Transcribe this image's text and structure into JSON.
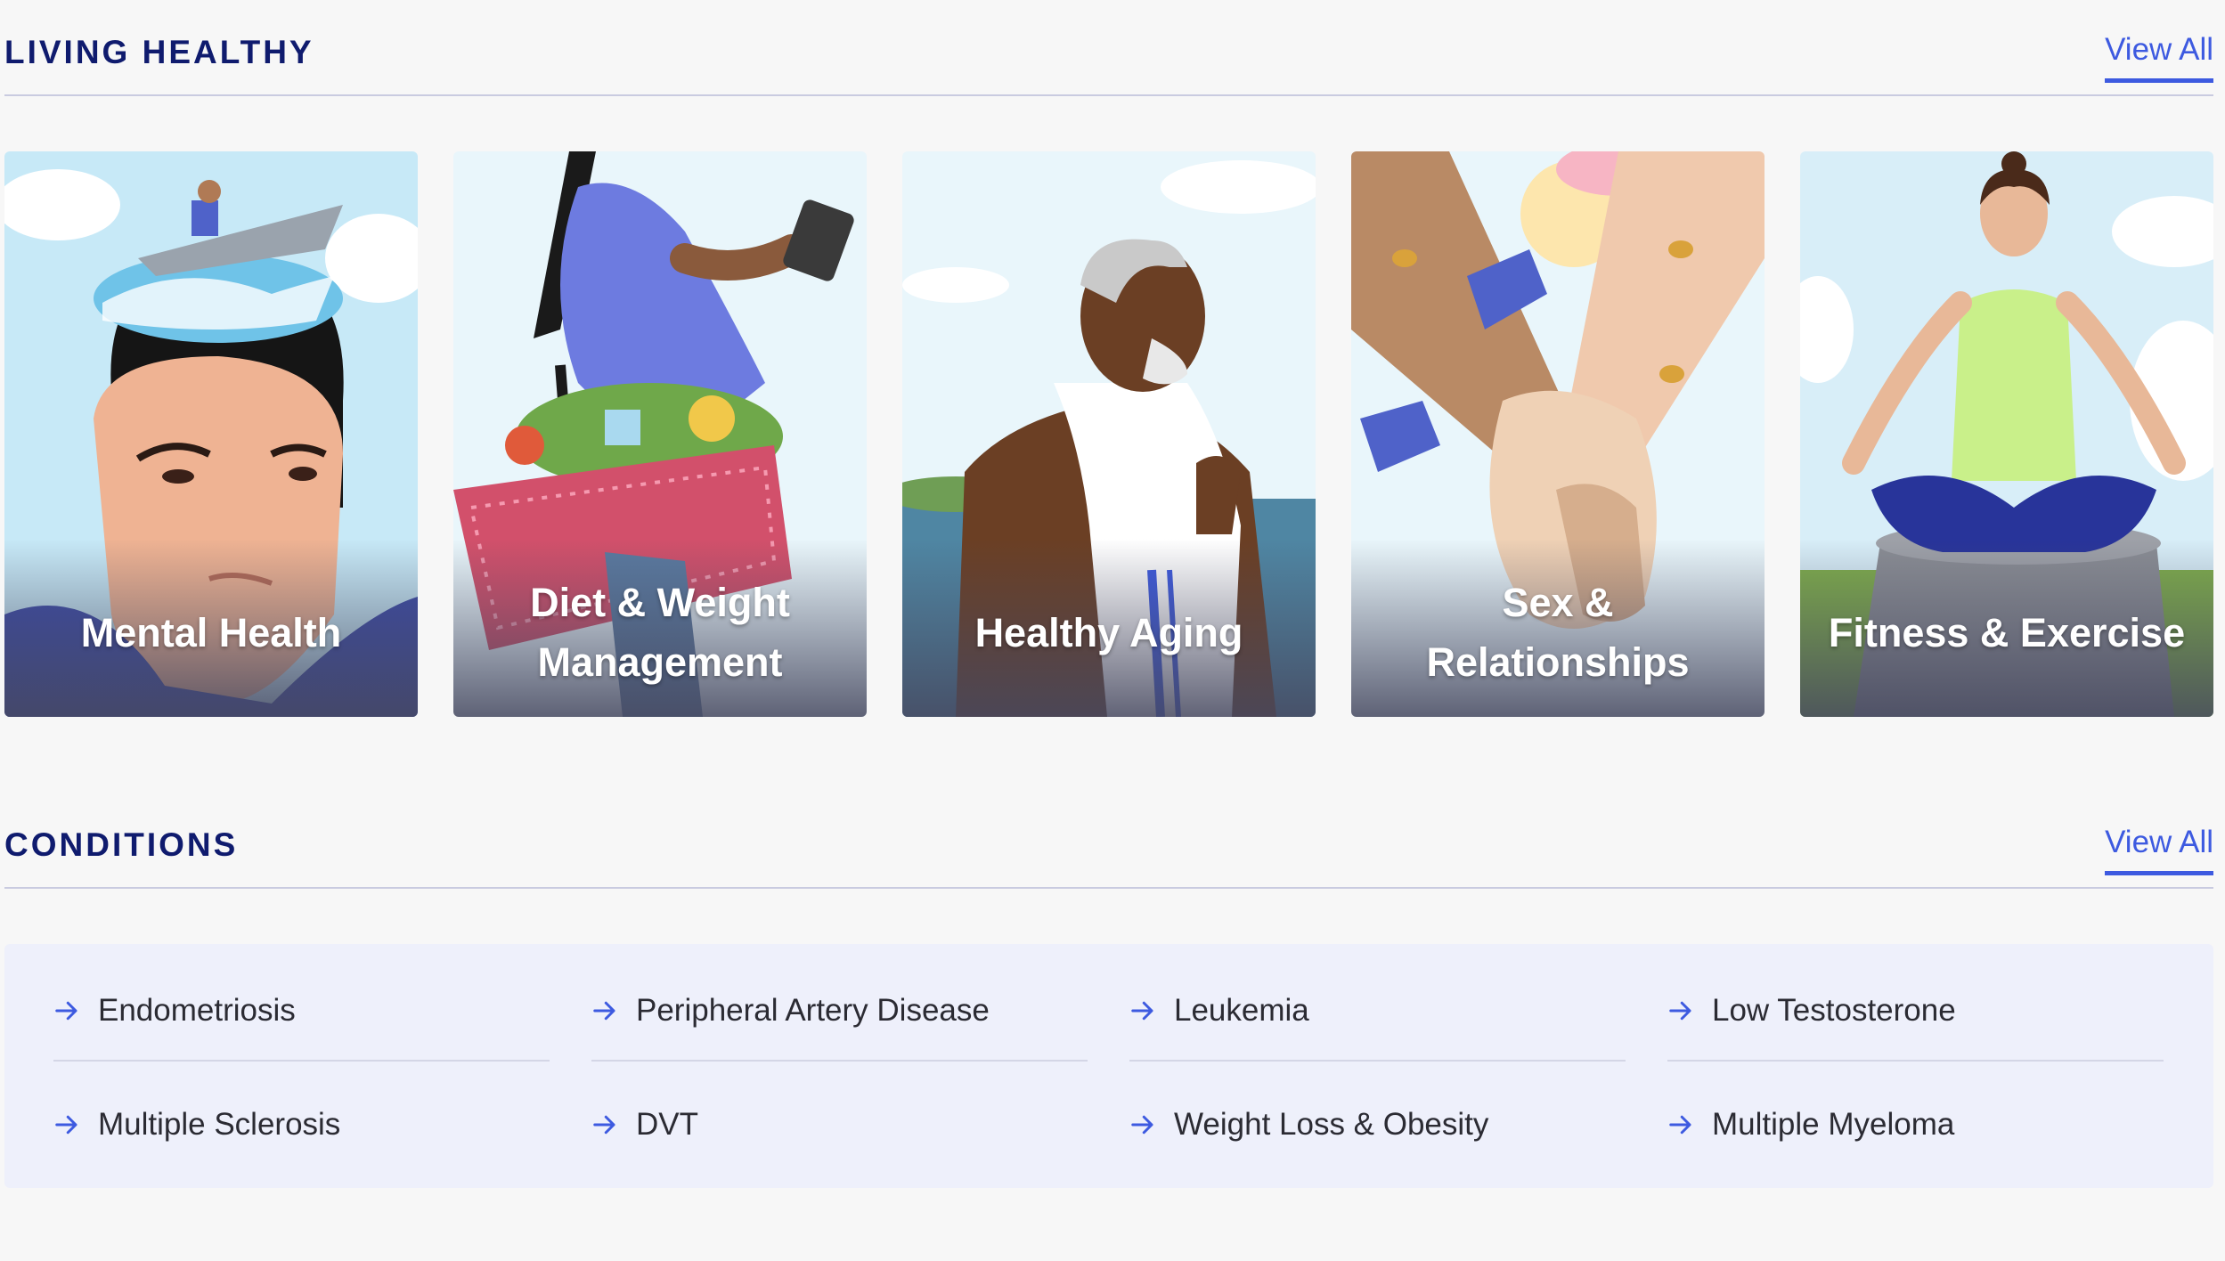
{
  "living_healthy": {
    "title": "LIVING HEALTHY",
    "view_all": "View All",
    "cards": [
      {
        "label": "Mental Health"
      },
      {
        "label": "Diet & Weight Management"
      },
      {
        "label": "Healthy Aging"
      },
      {
        "label": "Sex & Relationships"
      },
      {
        "label": "Fitness & Exercise"
      }
    ]
  },
  "conditions": {
    "title": "CONDITIONS",
    "view_all": "View All",
    "items": [
      "Endometriosis",
      "Peripheral Artery Disease",
      "Leukemia",
      "Low Testosterone",
      "Multiple Sclerosis",
      "DVT",
      "Weight Loss & Obesity",
      "Multiple Myeloma"
    ]
  },
  "colors": {
    "heading": "#0f1b6e",
    "accent": "#3d5ae0",
    "panel": "#eef0fb",
    "background": "#f7f7f7"
  },
  "icons": {
    "condition_link": "arrow-right-icon"
  }
}
